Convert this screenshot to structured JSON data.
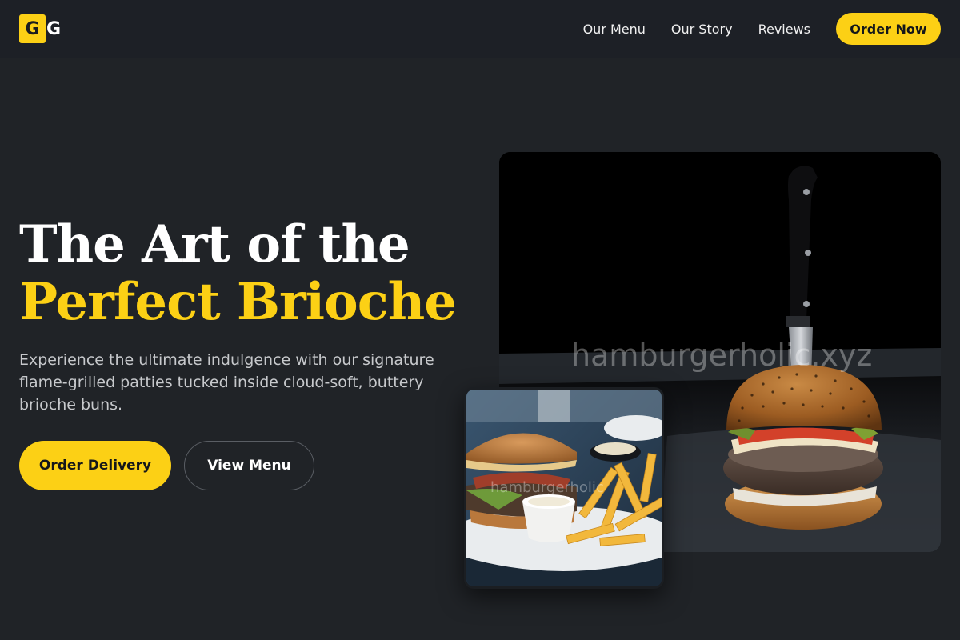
{
  "brand": {
    "logo_box_letter": "G",
    "logo_letter": "G"
  },
  "nav": {
    "links": [
      "Our Menu",
      "Our Story",
      "Reviews"
    ],
    "cta": "Order Now"
  },
  "hero": {
    "title_line1": "The Art of the",
    "title_line2": "Perfect Brioche",
    "description": "Experience the ultimate indulgence with our signature flame-grilled patties tucked inside cloud-soft, buttery brioche buns.",
    "primary_button": "Order Delivery",
    "secondary_button": "View Menu"
  },
  "images": {
    "main_watermark": "hamburgerholic.xyz",
    "small_watermark": "hamburgerholic"
  },
  "colors": {
    "accent": "#fcd015",
    "background": "#202327",
    "header": "#1d2026"
  }
}
